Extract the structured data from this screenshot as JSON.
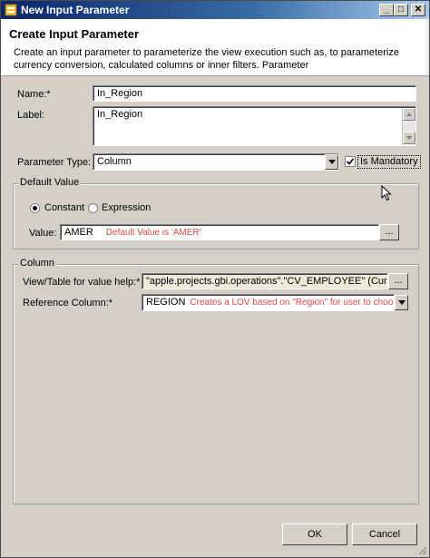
{
  "window": {
    "title": "New Input Parameter",
    "minimize_glyph": "_",
    "maximize_glyph": "□",
    "close_glyph": "✕"
  },
  "header": {
    "title": "Create Input Parameter",
    "description": "Create an input parameter to parameterize the view execution such as, to parameterize currency conversion, calculated columns or inner filters. Parameter"
  },
  "form": {
    "name_label": "Name:*",
    "name_value": "In_Region",
    "label_label": "Label:",
    "label_value": "In_Region",
    "param_type_label": "Parameter Type:",
    "param_type_value": "Column",
    "is_mandatory_label": "Is Mandatory",
    "is_mandatory_checked": true
  },
  "default_value": {
    "group_title": "Default Value",
    "constant_label": "Constant",
    "expression_label": "Expression",
    "selected": "Constant",
    "value_label": "Value:",
    "value": "AMER",
    "value_hint": "Default Value is 'AMER'",
    "browse_label": "..."
  },
  "column": {
    "group_title": "Column",
    "view_label": "View/Table for value help:*",
    "view_value": "\"apple.projects.gbi.operations\".\"CV_EMPLOYEE\" (Current V",
    "view_browse_label": "...",
    "ref_label": "Reference Column:*",
    "ref_value": "REGION",
    "ref_hint": "Creates a LOV based on \"Region\" for user to choose"
  },
  "footer": {
    "ok_label": "OK",
    "cancel_label": "Cancel"
  },
  "colors": {
    "hint": "#e0484a",
    "titlebar_start": "#0a246a",
    "dialog_bg": "#d4d0c8"
  }
}
